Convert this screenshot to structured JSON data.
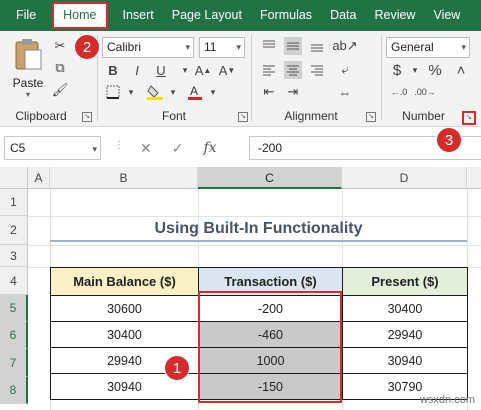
{
  "ribbon_tabs": [
    "File",
    "Home",
    "Insert",
    "Page Layout",
    "Formulas",
    "Data",
    "Review",
    "View"
  ],
  "clipboard": {
    "paste_label": "Paste",
    "group_label": "Clipboard"
  },
  "font": {
    "name": "Calibri",
    "size": "11",
    "bold": "B",
    "italic": "I",
    "underline": "U",
    "group_label": "Font"
  },
  "alignment": {
    "group_label": "Alignment"
  },
  "number": {
    "format": "General",
    "currency": "$",
    "percent": "%",
    "group_label": "Number"
  },
  "formula_bar": {
    "name_box": "C5",
    "fx": "fx",
    "value": "-200"
  },
  "badges": {
    "one": "1",
    "two": "2",
    "three": "3"
  },
  "columns": [
    "A",
    "B",
    "C",
    "D"
  ],
  "rows": [
    "1",
    "2",
    "3",
    "4",
    "5",
    "6",
    "7",
    "8"
  ],
  "sheet": {
    "title": "Using Built-In Functionality",
    "headers": [
      "Main Balance ($)",
      "Transaction ($)",
      "Present ($)"
    ],
    "data": [
      [
        "30600",
        "-200",
        "30400"
      ],
      [
        "30400",
        "-460",
        "29940"
      ],
      [
        "29940",
        "1000",
        "30940"
      ],
      [
        "30940",
        "-150",
        "30790"
      ]
    ]
  },
  "watermark": "wsxdn.com",
  "colors": {
    "excel_green": "#217346",
    "highlight_red": "#d42b2b",
    "header_yellow": "#fbf1c7",
    "header_blue": "#dce6f2",
    "header_green": "#e2efda"
  }
}
